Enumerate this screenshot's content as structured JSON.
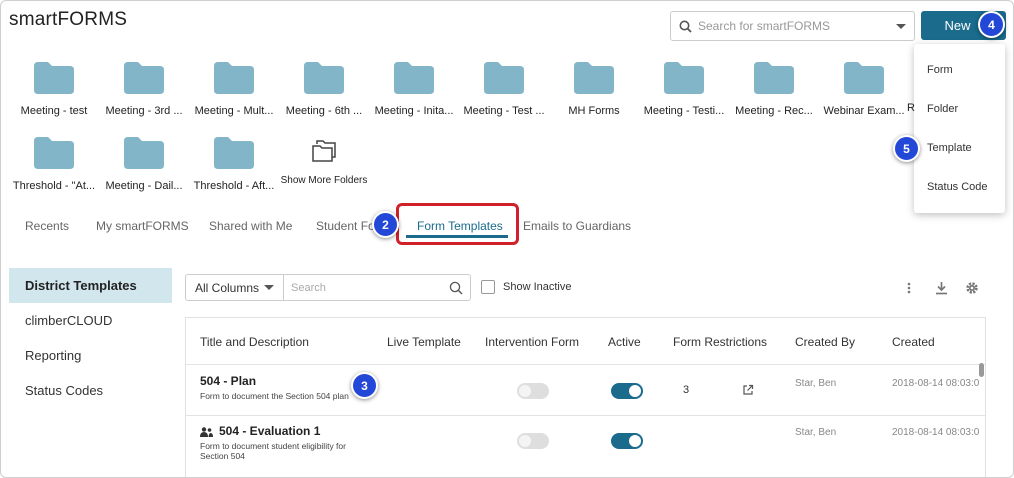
{
  "app": {
    "title": "smartFORMS"
  },
  "search": {
    "placeholder": "Search for smartFORMS"
  },
  "new_button": {
    "label": "New"
  },
  "new_menu": {
    "items": [
      "Form",
      "Folder",
      "Template",
      "Status Code"
    ]
  },
  "folders": [
    "Meeting - test",
    "Meeting - 3rd ...",
    "Meeting - Mult...",
    "Meeting - 6th ...",
    "Meeting - Inita...",
    "Meeting - Test ...",
    "MH Forms",
    "Meeting - Testi...",
    "Meeting - Rec...",
    "Webinar Exam...",
    "R",
    "Threshold - \"At...",
    "Meeting - Dail...",
    "Threshold - Aft..."
  ],
  "show_more_folders": "Show More Folders",
  "tabs": [
    "Recents",
    "My smartFORMS",
    "Shared with Me",
    "Student Fo",
    "Form Templates",
    "Emails to Guardians"
  ],
  "sidebar": {
    "items": [
      "District Templates",
      "climberCLOUD",
      "Reporting",
      "Status Codes"
    ]
  },
  "toolbar": {
    "column_select": "All Columns",
    "search_placeholder": "Search",
    "show_inactive": "Show Inactive"
  },
  "table": {
    "headers": [
      "Title and Description",
      "Live Template",
      "Intervention Form",
      "Active",
      "Form Restrictions",
      "Created By",
      "Created"
    ],
    "rows": [
      {
        "title": "504 - Plan",
        "description": "Form to document the Section 504 plan",
        "restrictions": "3",
        "created_by": "Star, Ben",
        "created": "2018-08-14 08:03:0"
      },
      {
        "title": "504 - Evaluation 1",
        "description": "Form to document student eligibility for Section 504",
        "restrictions": "",
        "created_by": "Star, Ben",
        "created": "2018-08-14 08:03:0"
      }
    ]
  },
  "annotations": {
    "b2": "2",
    "b3": "3",
    "b4": "4",
    "b5": "5"
  },
  "colors": {
    "accent": "#1a6b8c",
    "folder": "#82b5c8",
    "highlight": "#d0202a",
    "badge": "#2348d8"
  }
}
